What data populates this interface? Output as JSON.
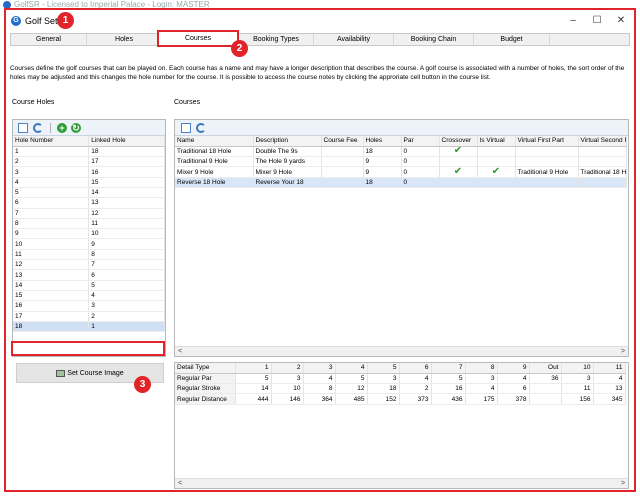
{
  "background_window": {
    "title": "GolfSR - Licensed to Imperial Palace - Login: MASTER"
  },
  "window": {
    "title": "Golf Setup",
    "minimize": "–",
    "maximize": "☐",
    "close": "✕"
  },
  "markers": [
    "1",
    "2",
    "3"
  ],
  "tabs": [
    "General",
    "Holes",
    "Courses",
    "Booking Types",
    "Availability",
    "Booking Chain",
    "Budget"
  ],
  "description": "Courses define the golf courses that can be played on. Each course has a name and may have a longer description that describes the course. A golf course is associated with a number of holes, the sort order of the holes may be adjusted and this changes the hole number for the course. It is possible to access the course notes by clicking the approriate cell button in the course list.",
  "course_holes": {
    "label": "Course Holes",
    "columns": [
      "Hole Number",
      "Linked Hole"
    ],
    "rows": [
      [
        "1",
        "18"
      ],
      [
        "2",
        "17"
      ],
      [
        "3",
        "16"
      ],
      [
        "4",
        "15"
      ],
      [
        "5",
        "14"
      ],
      [
        "6",
        "13"
      ],
      [
        "7",
        "12"
      ],
      [
        "8",
        "11"
      ],
      [
        "9",
        "10"
      ],
      [
        "10",
        "9"
      ],
      [
        "11",
        "8"
      ],
      [
        "12",
        "7"
      ],
      [
        "13",
        "6"
      ],
      [
        "14",
        "5"
      ],
      [
        "15",
        "4"
      ],
      [
        "16",
        "3"
      ],
      [
        "17",
        "2"
      ],
      [
        "18",
        "1"
      ]
    ],
    "set_image_label": "Set Course Image"
  },
  "courses": {
    "label": "Courses",
    "columns": [
      "Name",
      "Description",
      "Course Fee",
      "Holes",
      "Par",
      "Crossover",
      "Is Virtual",
      "Virtual First Part",
      "Virtual Second F"
    ],
    "rows": [
      {
        "name": "Traditional 18 Hole",
        "description": "Double The 9s",
        "fee": "",
        "holes": "18",
        "par": "0",
        "crossover": "✔",
        "virtual": "",
        "first": "",
        "second": ""
      },
      {
        "name": "Traditional 9 Hole",
        "description": "The Hole 9 yards",
        "fee": "",
        "holes": "9",
        "par": "0",
        "crossover": "",
        "virtual": "",
        "first": "",
        "second": ""
      },
      {
        "name": "Mixer 9 Hole",
        "description": "Mixer 9 Hole",
        "fee": "",
        "holes": "9",
        "par": "0",
        "crossover": "✔",
        "virtual": "✔",
        "first": "Traditional 9 Hole",
        "second": "Traditional 18 H"
      },
      {
        "name": "Reverse 18 Hole",
        "description": "Reverse Your 18",
        "fee": "",
        "holes": "18",
        "par": "0",
        "crossover": "",
        "virtual": "",
        "first": "",
        "second": ""
      }
    ]
  },
  "details": {
    "columns": [
      "Detail Type",
      "1",
      "2",
      "3",
      "4",
      "5",
      "6",
      "7",
      "8",
      "9",
      "Out",
      "10",
      "11"
    ],
    "rows": [
      [
        "Regular Par",
        "5",
        "3",
        "4",
        "5",
        "3",
        "4",
        "5",
        "3",
        "4",
        "36",
        "3",
        "4"
      ],
      [
        "Regular Stroke",
        "14",
        "10",
        "8",
        "12",
        "18",
        "2",
        "16",
        "4",
        "6",
        "",
        "11",
        "13"
      ],
      [
        "Regular Distance",
        "444",
        "146",
        "364",
        "485",
        "152",
        "373",
        "436",
        "175",
        "378",
        "",
        "156",
        "345"
      ]
    ]
  },
  "scroll": {
    "left": "<",
    "right": ">"
  }
}
